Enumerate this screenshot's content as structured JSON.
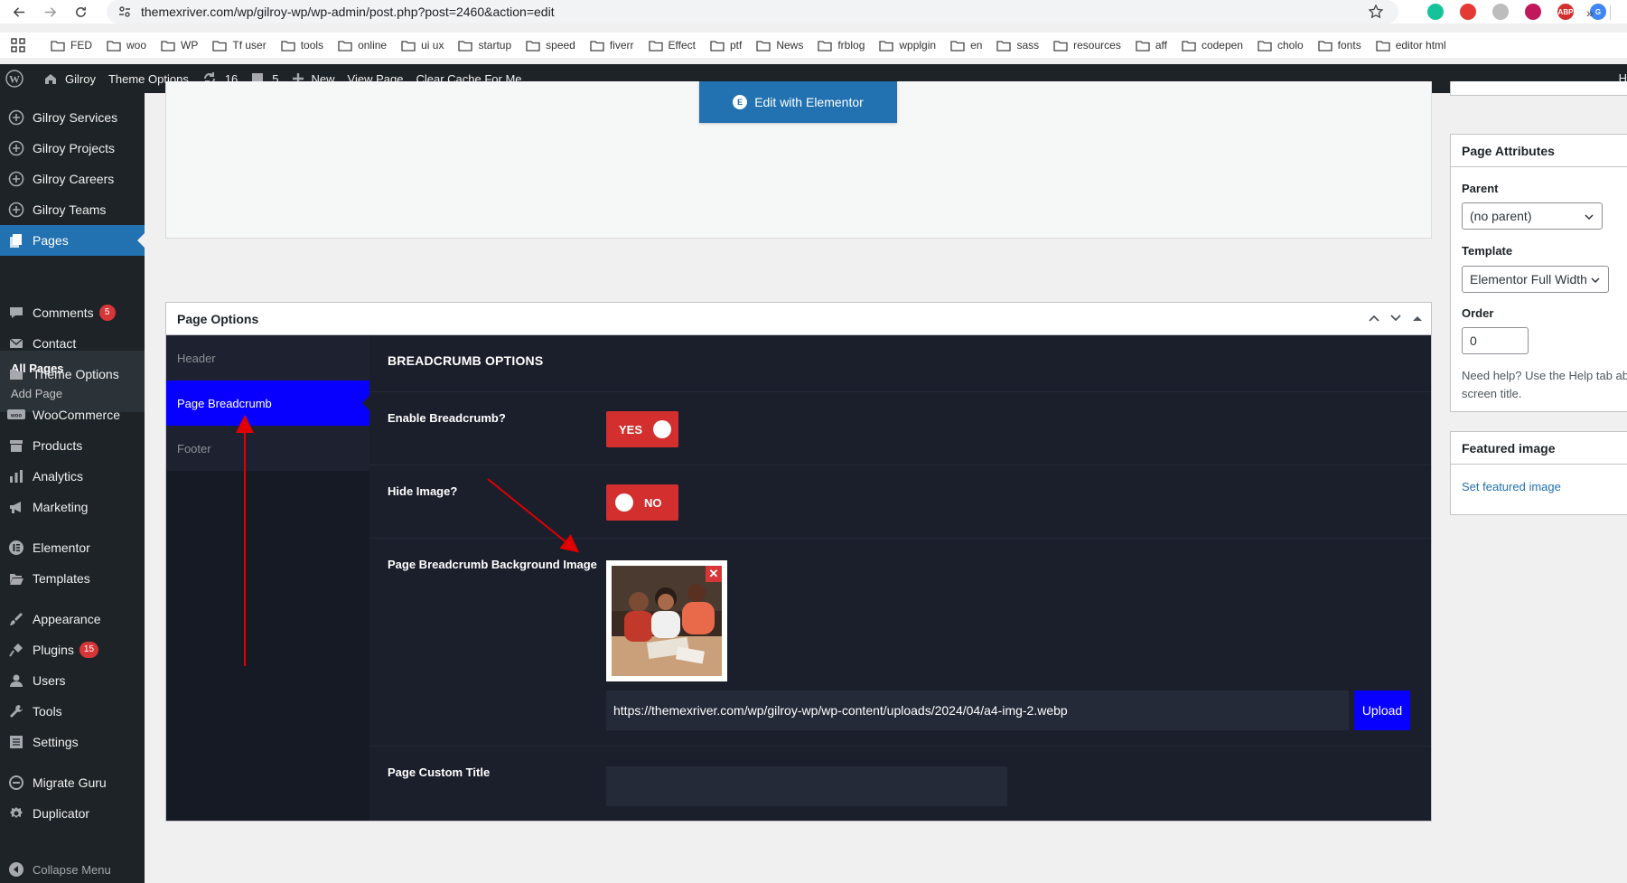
{
  "browser": {
    "url": "themexriver.com/wp/gilroy-wp/wp-admin/post.php?post=2460&action=edit",
    "bookmarks": [
      "FED",
      "woo",
      "WP",
      "Tf user",
      "tools",
      "online",
      "ui ux",
      "startup",
      "speed",
      "fiverr",
      "Effect",
      "ptf",
      "News",
      "frblog",
      "wpplgin",
      "en",
      "sass",
      "resources",
      "aff",
      "codepen",
      "cholo",
      "fonts",
      "editor html"
    ],
    "bookmarks_more": "»",
    "extensions": [
      {
        "name": "grammarly-icon",
        "color": "#15c39a",
        "label": ""
      },
      {
        "name": "pen-extension-icon",
        "color": "#e53935",
        "label": ""
      },
      {
        "name": "gray-extension-icon",
        "color": "#bdbdbd",
        "label": ""
      },
      {
        "name": "colorzilla-icon",
        "color": "#c2185b",
        "label": ""
      },
      {
        "name": "adblock-plus-icon",
        "color": "#d32f2f",
        "label": "ABP"
      },
      {
        "name": "google-translate-icon",
        "color": "#4285f4",
        "label": "G"
      }
    ]
  },
  "adminbar": {
    "site": "Gilroy",
    "theme_options": "Theme Options",
    "updates": "16",
    "comments": "5",
    "new": "New",
    "view_page": "View Page",
    "clear_cache": "Clear Cache For Me",
    "right_label": "H"
  },
  "sidebar": {
    "items": [
      {
        "label": "Gilroy Services",
        "icon": "plus-circle-icon"
      },
      {
        "label": "Gilroy Projects",
        "icon": "plus-circle-icon"
      },
      {
        "label": "Gilroy Careers",
        "icon": "plus-circle-icon"
      },
      {
        "label": "Gilroy Teams",
        "icon": "plus-circle-icon"
      },
      {
        "label": "Pages",
        "icon": "pages-icon"
      },
      {
        "label": "Comments",
        "icon": "comment-icon",
        "badge": "5"
      },
      {
        "label": "Contact",
        "icon": "mail-icon"
      },
      {
        "label": "Theme Options",
        "icon": "folder-icon"
      },
      {
        "label": "WooCommerce",
        "icon": "woo-icon"
      },
      {
        "label": "Products",
        "icon": "archive-icon"
      },
      {
        "label": "Analytics",
        "icon": "chart-bar-icon"
      },
      {
        "label": "Marketing",
        "icon": "megaphone-icon"
      },
      {
        "label": "Elementor",
        "icon": "elementor-icon"
      },
      {
        "label": "Templates",
        "icon": "folder-open-icon"
      },
      {
        "label": "Appearance",
        "icon": "brush-icon"
      },
      {
        "label": "Plugins",
        "icon": "plug-icon",
        "badge": "15"
      },
      {
        "label": "Users",
        "icon": "user-icon"
      },
      {
        "label": "Tools",
        "icon": "wrench-icon"
      },
      {
        "label": "Settings",
        "icon": "settings-icon"
      },
      {
        "label": "Migrate Guru",
        "icon": "migrate-icon"
      },
      {
        "label": "Duplicator",
        "icon": "duplicator-icon"
      }
    ],
    "submenu": {
      "all_pages": "All Pages",
      "add_page": "Add Page"
    },
    "collapse": "Collapse Menu"
  },
  "editor": {
    "elementor_button": "Edit with Elementor"
  },
  "page_options": {
    "title": "Page Options",
    "tabs": [
      "Header",
      "Page Breadcrumb",
      "Footer"
    ],
    "active_tab": "Page Breadcrumb",
    "section_title": "BREADCRUMB OPTIONS",
    "enable_breadcrumb": {
      "label": "Enable Breadcrumb?",
      "value": "YES"
    },
    "hide_image": {
      "label": "Hide Image?",
      "value": "NO"
    },
    "bg_image": {
      "label": "Page Breadcrumb Background Image",
      "url": "https://themexriver.com/wp/gilroy-wp/wp-content/uploads/2024/04/a4-img-2.webp",
      "remove": "✕",
      "upload_button": "Upload"
    },
    "custom_title": {
      "label": "Page Custom Title",
      "value": ""
    }
  },
  "page_attributes": {
    "title": "Page Attributes",
    "parent_label": "Parent",
    "parent_value": "(no parent)",
    "template_label": "Template",
    "template_value": "Elementor Full Width",
    "order_label": "Order",
    "order_value": "0",
    "help_line1": "Need help? Use the Help tab ab",
    "help_line2": "screen title."
  },
  "featured_image": {
    "title": "Featured image",
    "link": "Set featured image"
  },
  "colors": {
    "accent": "#2271b1",
    "toggle": "#d32f2f",
    "tab_active": "#0800ff",
    "panel": "#1b1f2b"
  }
}
